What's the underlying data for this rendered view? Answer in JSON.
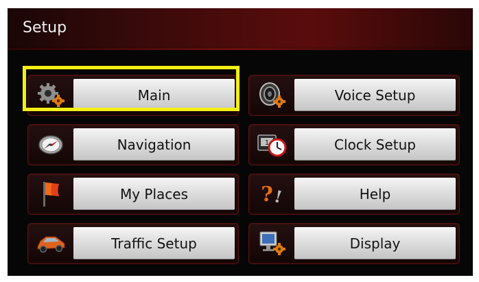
{
  "header": {
    "title": "Setup"
  },
  "tiles": [
    {
      "label": "Main",
      "icon": "gears-icon"
    },
    {
      "label": "Voice Setup",
      "icon": "speaker-icon"
    },
    {
      "label": "Navigation",
      "icon": "compass-icon"
    },
    {
      "label": "Clock Setup",
      "icon": "clock-icon"
    },
    {
      "label": "My Places",
      "icon": "flag-icon"
    },
    {
      "label": "Help",
      "icon": "question-icon"
    },
    {
      "label": "Traffic Setup",
      "icon": "car-icon"
    },
    {
      "label": "Display",
      "icon": "monitor-icon"
    }
  ],
  "selected_tile": "Main",
  "colors": {
    "highlight": "#f4ef15",
    "title_bar": "#5a0c0c",
    "background": "#060606"
  }
}
